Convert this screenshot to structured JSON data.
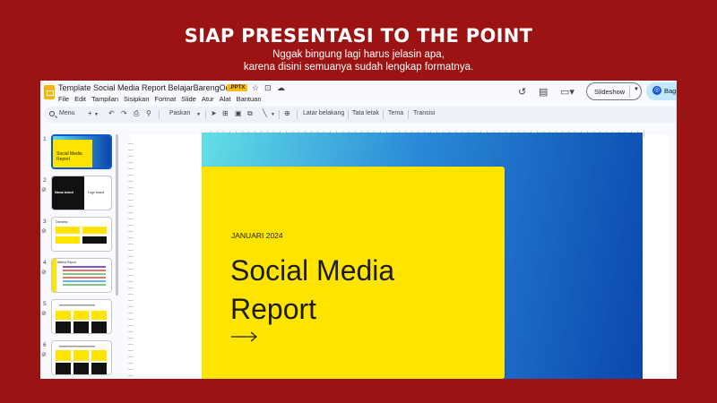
{
  "banner": {
    "headline": "SIAP PRESENTASI TO THE POINT",
    "sub1": "Nggak bingung lagi harus jelasin apa,",
    "sub2": "karena disini semuanya sudah lengkap formatnya."
  },
  "app": {
    "doc_title": "Template Social Media Report BelajarBarengOdan",
    "file_badge": ".PPTX",
    "menus": [
      "File",
      "Edit",
      "Tampilan",
      "Sisipkan",
      "Format",
      "Slide",
      "Atur",
      "Alat",
      "Bantuan"
    ],
    "slideshow_label": "Slideshow",
    "share_label": "Bagik",
    "toolbar": {
      "menu_label": "Menu",
      "zoom_label": "Paskan",
      "background": "Latar belakang",
      "layout": "Tata letak",
      "theme": "Tema",
      "transition": "Transisi"
    },
    "slide_numbers": [
      "1",
      "2",
      "3",
      "4",
      "5",
      "6"
    ],
    "thumbs": {
      "t1_title": "Social Media Report",
      "t2_left": "Nama brand",
      "t2_right": "Logo brand",
      "t3_title": "Overview",
      "t4_title": "Metrics Report"
    }
  },
  "slide": {
    "date": "JANUARI 2024",
    "title_line1": "Social Media",
    "title_line2": "Report"
  },
  "colors": {
    "background": "#9b1313",
    "slide_yellow": "#ffe400",
    "gradient_start": "#63dfe6",
    "gradient_end": "#0a47ad",
    "accent_blue": "#0b57d0"
  }
}
